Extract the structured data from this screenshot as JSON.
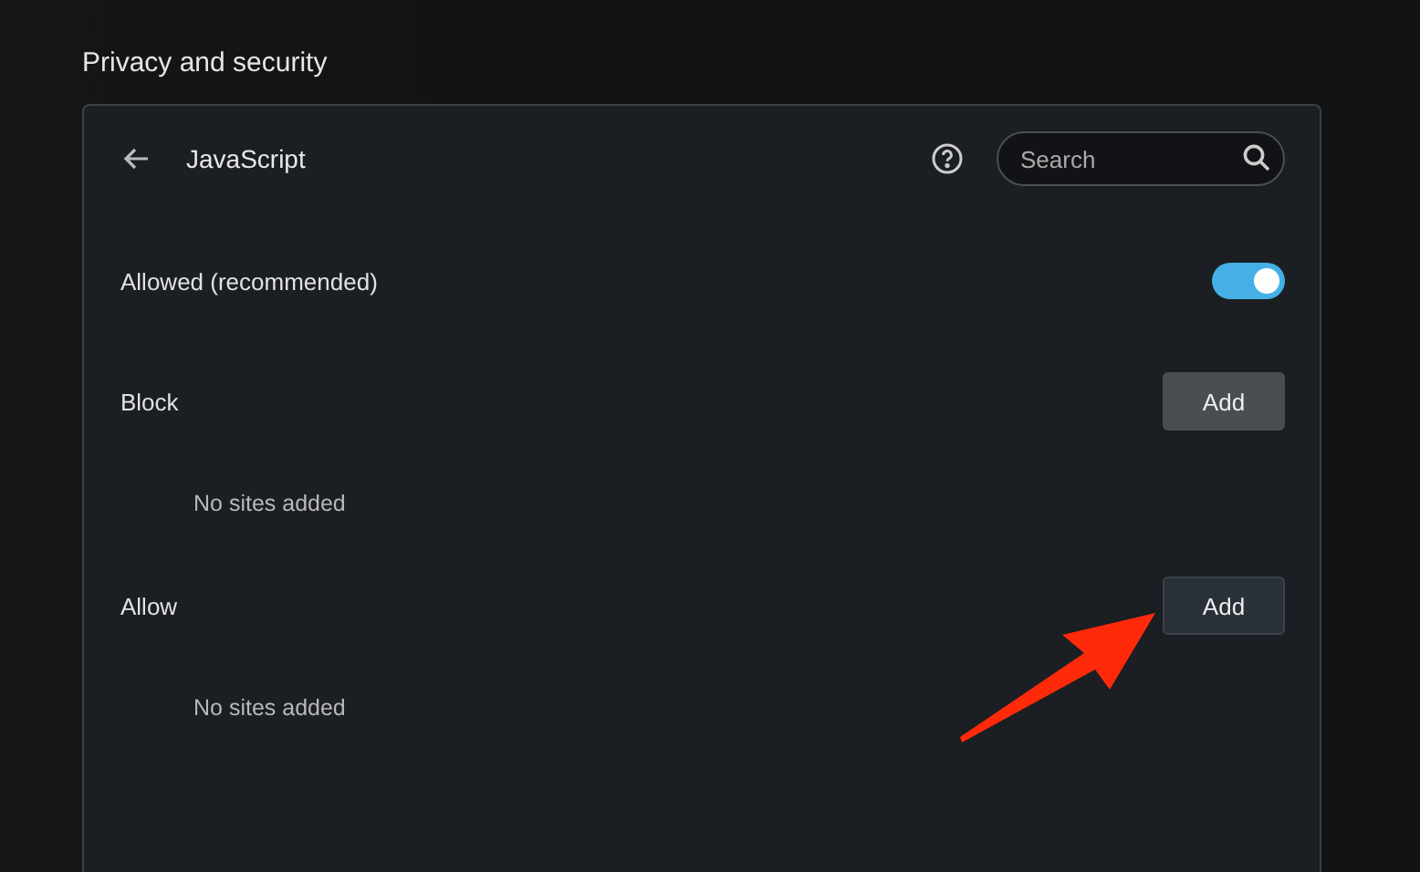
{
  "section_title": "Privacy and security",
  "panel": {
    "title": "JavaScript",
    "search": {
      "placeholder": "Search"
    },
    "toggle": {
      "label": "Allowed (recommended)",
      "on": true
    },
    "lists": [
      {
        "label": "Block",
        "button": {
          "label": "Add",
          "hovered": true
        },
        "empty_text": "No sites added"
      },
      {
        "label": "Allow",
        "button": {
          "label": "Add",
          "hovered": false
        },
        "empty_text": "No sites added"
      }
    ]
  }
}
